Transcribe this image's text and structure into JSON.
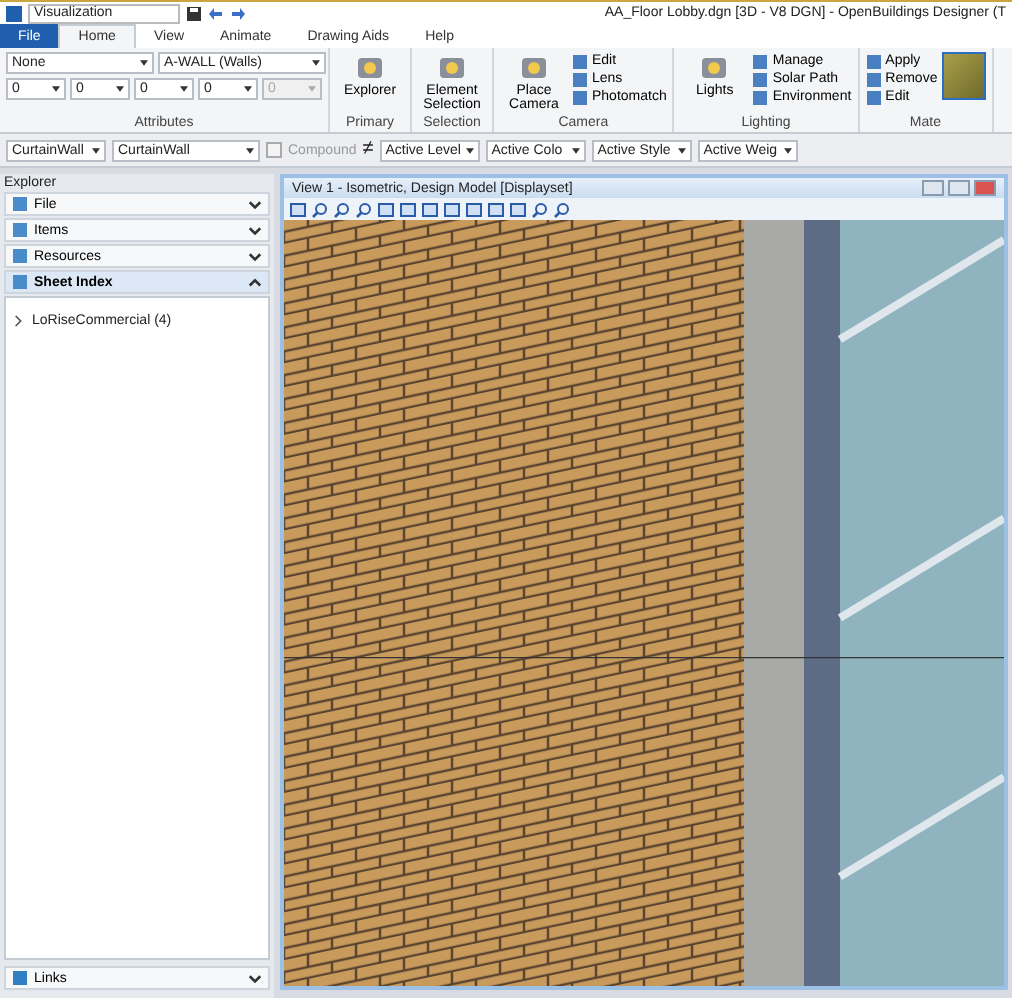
{
  "title_bar": {
    "workflow": "Visualization",
    "title": "AA_Floor Lobby.dgn [3D - V8 DGN] - OpenBuildings Designer (T"
  },
  "tabs": [
    {
      "label": "File",
      "kind": "file",
      "selected": false
    },
    {
      "label": "Home",
      "kind": "tab",
      "selected": true
    },
    {
      "label": "View",
      "kind": "tab",
      "selected": false
    },
    {
      "label": "Animate",
      "kind": "tab",
      "selected": false
    },
    {
      "label": "Drawing Aids",
      "kind": "tab",
      "selected": false
    },
    {
      "label": "Help",
      "kind": "tab",
      "selected": false
    }
  ],
  "attributes": {
    "label": "Attributes",
    "level": "None",
    "element_template": "A-WALL (Walls)",
    "combos": [
      {
        "value": "0",
        "disabled": false
      },
      {
        "value": "0",
        "disabled": false
      },
      {
        "value": "0",
        "disabled": false
      },
      {
        "value": "0",
        "disabled": false
      },
      {
        "value": "0",
        "disabled": true
      }
    ]
  },
  "ribbon_groups": [
    {
      "label": "Primary",
      "big": "Explorer"
    },
    {
      "label": "Selection",
      "big": "Element Selection"
    },
    {
      "label": "Camera",
      "big": "Place Camera",
      "items": [
        "Edit",
        "Lens",
        "Photomatch"
      ]
    },
    {
      "label": "Lighting",
      "big": "Lights",
      "items": [
        "Manage",
        "Solar Path",
        "Environment"
      ]
    },
    {
      "label": "Mate",
      "items": [
        "Apply",
        "Remove",
        "Edit"
      ]
    }
  ],
  "toolbar": {
    "template": "CurtainWall",
    "type": "CurtainWall",
    "compound": {
      "label": "Compound",
      "checked": false,
      "disabled": true
    },
    "not_equal": "≠",
    "actives": [
      "Active Level",
      "Active Colo",
      "Active Style",
      "Active Weig"
    ]
  },
  "explorer": {
    "title": "Explorer",
    "sections": [
      {
        "label": "File",
        "expanded": false
      },
      {
        "label": "Items",
        "expanded": false
      },
      {
        "label": "Resources",
        "expanded": false
      },
      {
        "label": "Sheet Index",
        "expanded": true
      }
    ],
    "tree": [
      {
        "label": "LoRiseCommercial (4)",
        "expanded": false
      }
    ],
    "links": {
      "label": "Links",
      "expanded": false
    }
  },
  "view": {
    "title": "View 1 - Isometric, Design Model [Displayset]"
  }
}
